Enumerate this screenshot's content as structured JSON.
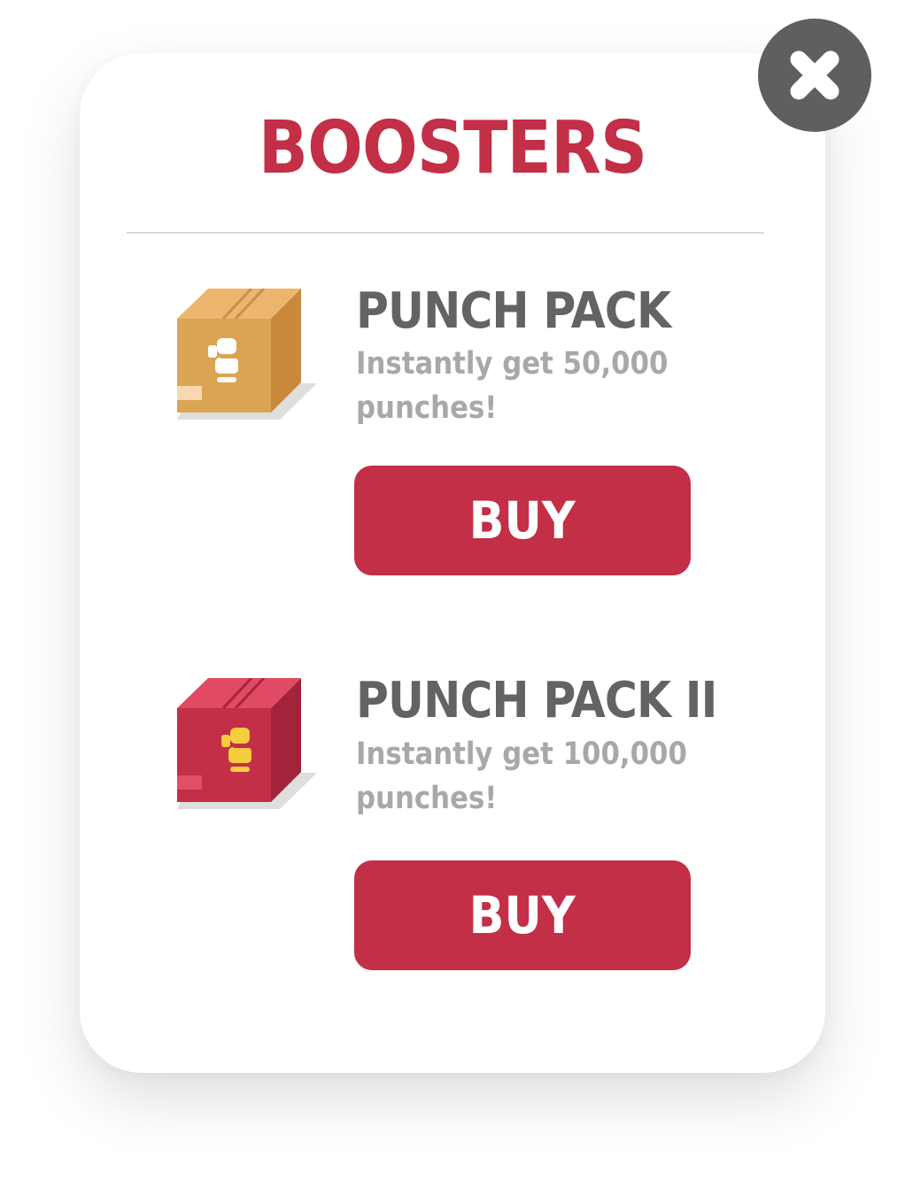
{
  "dialog": {
    "title": "BOOSTERS",
    "close_icon": "close-x-icon",
    "colors": {
      "accent": "#c22f46",
      "close_bg": "#5f5f5f",
      "name_text": "#636363",
      "desc_text": "#a8a8a8"
    }
  },
  "items": [
    {
      "name": "PUNCH PACK",
      "description": "Instantly get 50,000 punches!",
      "button_label": "BUY",
      "icon": "brown-box-boxing-glove-icon"
    },
    {
      "name": "PUNCH PACK II",
      "description": "Instantly get 100,000 punches!",
      "button_label": "BUY",
      "icon": "red-box-boxing-glove-icon"
    }
  ]
}
